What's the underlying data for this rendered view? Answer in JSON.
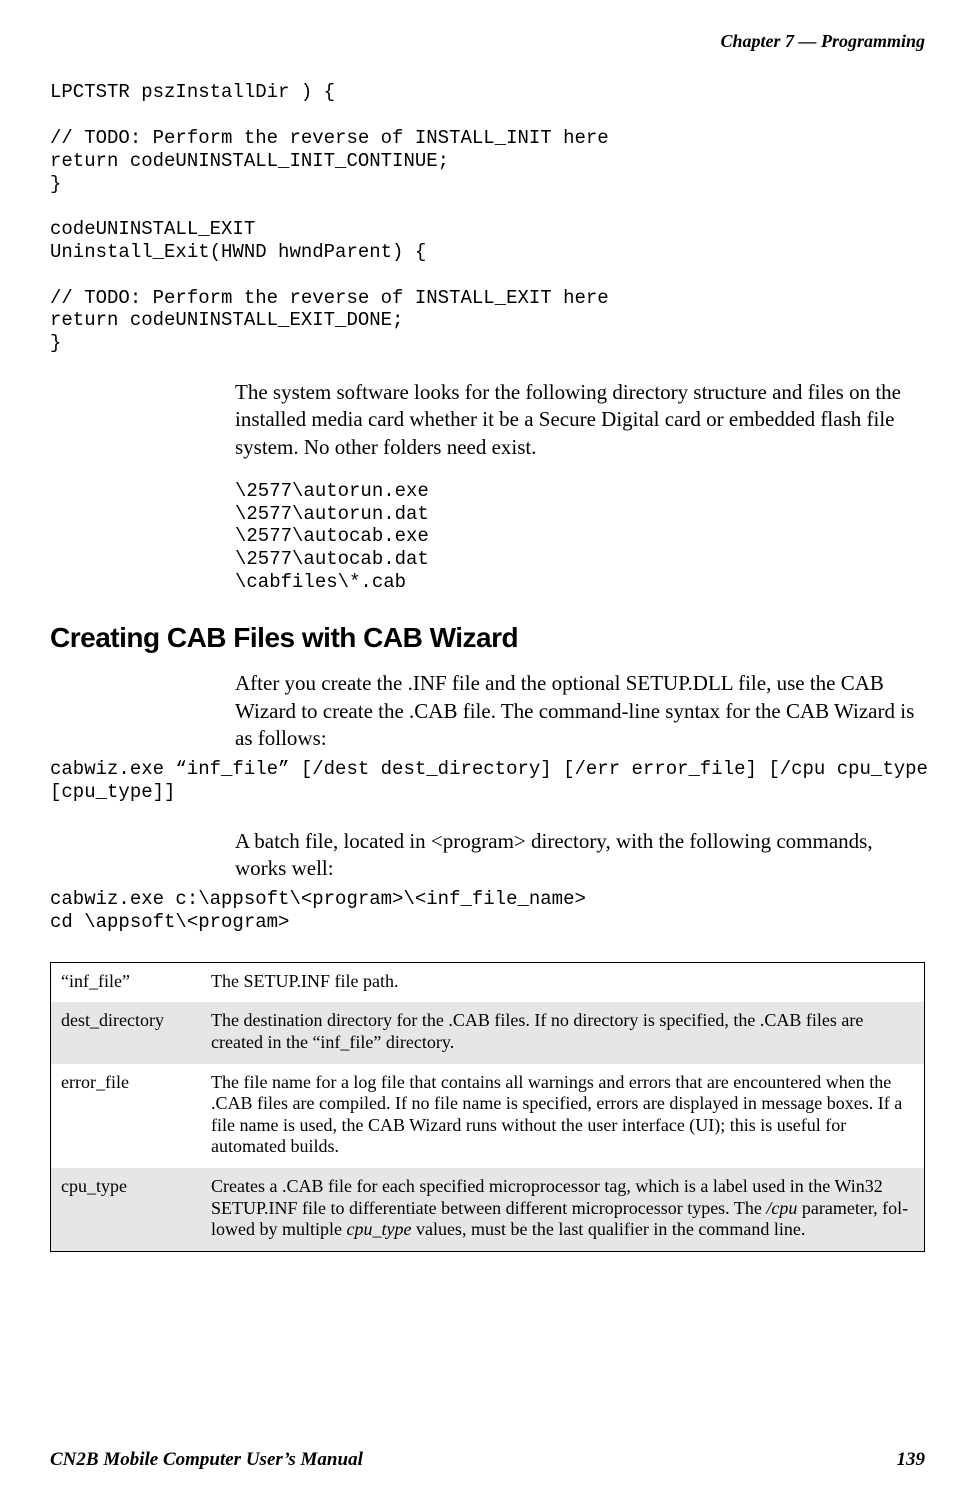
{
  "header": {
    "chapter": "Chapter 7 —  Programming"
  },
  "code1": "LPCTSTR pszInstallDir ) {\n\n// TODO: Perform the reverse of INSTALL_INIT here\nreturn codeUNINSTALL_INIT_CONTINUE;\n}\n\ncodeUNINSTALL_EXIT\nUninstall_Exit(HWND hwndParent) {\n\n// TODO: Perform the reverse of INSTALL_EXIT here\nreturn codeUNINSTALL_EXIT_DONE;\n}",
  "para1": "The system software looks for the following directory structure and files on the installed media card whether it be a Secure Digital card or embedded flash file system. No other folders need exist.",
  "paths": "\\2577\\autorun.exe\n\\2577\\autorun.dat\n\\2577\\autocab.exe\n\\2577\\autocab.dat\n\\cabfiles\\*.cab",
  "section_title": "Creating CAB Files with CAB Wizard",
  "para2": "After you create the .INF file and the optional SETUP.DLL file, use the CAB Wizard to create the .CAB file. The command-line syntax for the CAB Wizard is as follows:",
  "syntax": "cabwiz.exe “inf_file” [/dest dest_directory] [/err error_file] [/cpu cpu_type\n[cpu_type]]",
  "para3": "A batch file, located in <program> directory, with the following com­mands, works well:",
  "batch": "cabwiz.exe c:\\appsoft\\<program>\\<inf_file_name>\ncd \\appsoft\\<program>",
  "table": {
    "rows": [
      {
        "param": "“inf_file”",
        "desc": "The SETUP.INF file path."
      },
      {
        "param": "dest_directory",
        "desc": "The destination directory for the .CAB files. If no directory is specified, the .CAB files are created in the “inf_file” directory."
      },
      {
        "param": "error_file",
        "desc": "The file name for a log file that contains all warnings and errors that are encountered when the .CAB files are compiled. If no file name is specified, errors are displayed in message boxes. If a file name is used, the CAB Wizard runs without the user interface (UI); this is useful for automated builds."
      },
      {
        "param": "cpu_type",
        "desc_pre": "Creates a .CAB file for each specified microprocessor tag, which is a label used in the Win32 SETUP.INF file to differentiate between different microprocessor types. The ",
        "desc_i1": "/cpu",
        "desc_mid": " parameter, fol­lowed by multiple ",
        "desc_i2": "cpu_type",
        "desc_post": " values, must be the last qualifier in the command line."
      }
    ]
  },
  "footer": {
    "left": "CN2B Mobile Computer User’s Manual",
    "right": "139"
  }
}
